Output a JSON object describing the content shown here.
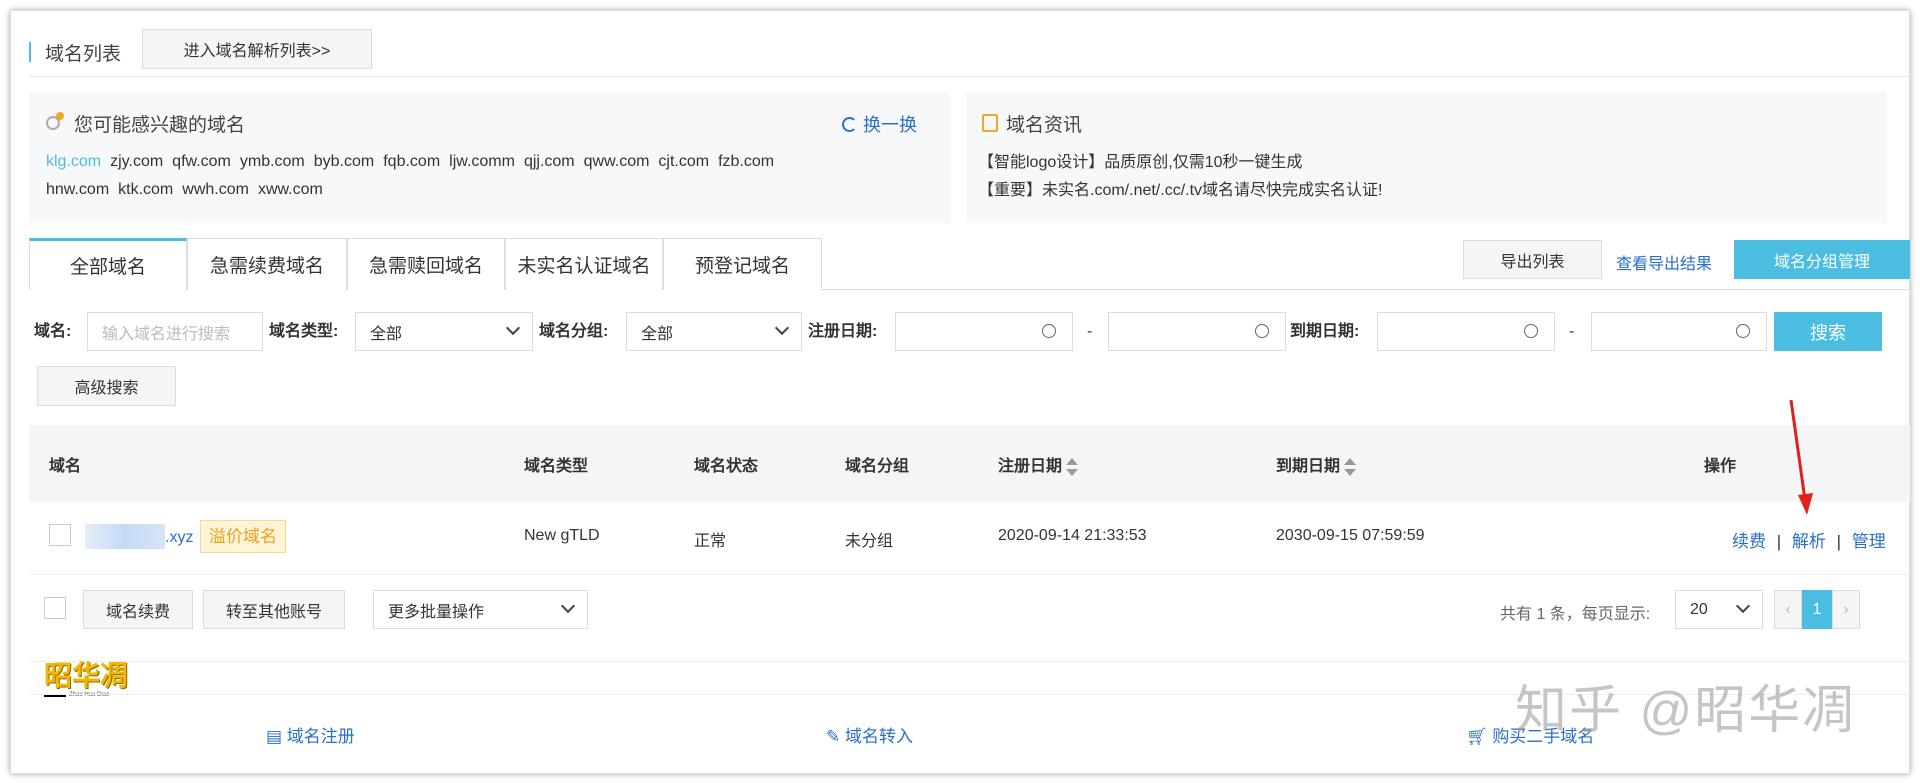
{
  "header": {
    "title": "域名列表",
    "enter_dns_button": "进入域名解析列表>>"
  },
  "suggest": {
    "title": "您可能感兴趣的域名",
    "refresh_label": "换一换",
    "domains": [
      "klg.com",
      "zjy.com",
      "qfw.com",
      "ymb.com",
      "byb.com",
      "fqb.com",
      "ljw.comm",
      "qjj.com",
      "qww.com",
      "cjt.com",
      "fzb.com",
      "hnw.com",
      "ktk.com",
      "wwh.com",
      "xww.com"
    ]
  },
  "news": {
    "title": "域名资讯",
    "items": [
      "【智能logo设计】品质原创,仅需10秒一键生成",
      "【重要】未实名.com/.net/.cc/.tv域名请尽快完成实名认证!"
    ]
  },
  "tabs": [
    "全部域名",
    "急需续费域名",
    "急需赎回域名",
    "未实名认证域名",
    "预登记域名"
  ],
  "actions": {
    "export": "导出列表",
    "view_export": "查看导出结果",
    "group_manage": "域名分组管理"
  },
  "filters": {
    "domain_label": "域名:",
    "domain_placeholder": "输入域名进行搜索",
    "type_label": "域名类型:",
    "type_value": "全部",
    "group_label": "域名分组:",
    "group_value": "全部",
    "reg_label": "注册日期:",
    "exp_label": "到期日期:",
    "dash": "-",
    "search": "搜索",
    "advanced": "高级搜索"
  },
  "table": {
    "headers": [
      "域名",
      "域名类型",
      "域名状态",
      "域名分组",
      "注册日期",
      "到期日期",
      "操作"
    ],
    "rows": [
      {
        "domain_suffix": ".xyz",
        "badge": "溢价域名",
        "type": "New gTLD",
        "status": "正常",
        "group": "未分组",
        "reg_date": "2020-09-14 21:33:53",
        "exp_date": "2030-09-15 07:59:59",
        "ops": [
          "续费",
          "解析",
          "管理"
        ],
        "sep": "|"
      }
    ]
  },
  "batch": {
    "renew": "域名续费",
    "transfer": "转至其他账号",
    "more": "更多批量操作"
  },
  "pager": {
    "summary": "共有 1 条，每页显示:",
    "page_size": "20",
    "current": "1",
    "prev": "‹",
    "next": "›"
  },
  "footer": {
    "register": "域名注册",
    "transfer_in": "域名转入",
    "buy_used": "购买二手域名"
  },
  "logo": {
    "text": "昭华凋",
    "sub": "Zhao Hua Diao"
  },
  "watermark": "知乎 @昭华凋",
  "colors": {
    "accent": "#4bbde0",
    "link": "#2a6fc9",
    "badge_bg": "#fff4d6",
    "badge_text": "#e8a020",
    "arrow": "#e02020"
  }
}
